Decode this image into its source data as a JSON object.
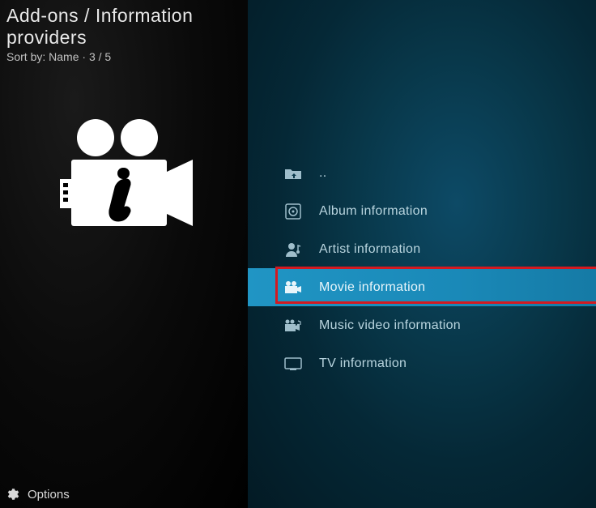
{
  "header": {
    "breadcrumb": "Add-ons / Information providers",
    "sort_label": "Sort by: Name",
    "position": "3 / 5"
  },
  "list": {
    "items": [
      {
        "icon": "folder-up",
        "label": ".."
      },
      {
        "icon": "album",
        "label": "Album information"
      },
      {
        "icon": "artist",
        "label": "Artist information"
      },
      {
        "icon": "movie",
        "label": "Movie information",
        "selected": true
      },
      {
        "icon": "music-video",
        "label": "Music video information"
      },
      {
        "icon": "tv",
        "label": "TV information"
      }
    ]
  },
  "footer": {
    "options_label": "Options"
  },
  "colors": {
    "highlight": "#2095c4",
    "outline": "#d41920",
    "text": "#b8d4de"
  }
}
